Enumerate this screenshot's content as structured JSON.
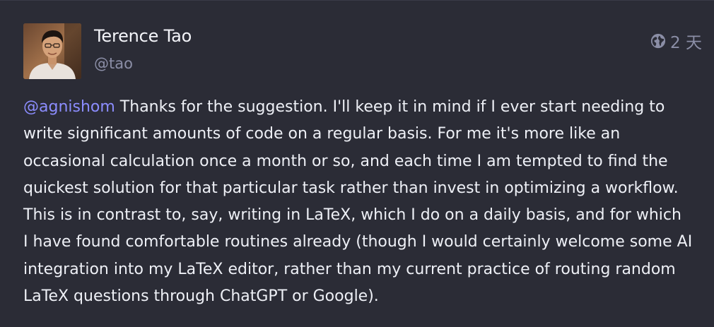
{
  "author": {
    "name": "Terence Tao",
    "handle": "@tao"
  },
  "timestamp": "2 天",
  "visibility_icon": "globe-icon",
  "post": {
    "mention": "@agnishom",
    "lines": [
      " Thanks for the suggestion.  I'll keep it in mind if I ever start needing to",
      "write significant amounts of code on a regular basis.  For me it's more like an",
      "occasional calculation once a month or so, and each time I am tempted to find the",
      "quickest solution for that particular task rather than invest in optimizing a workflow.",
      "This is in contrast to, say, writing in LaTeX, which I do on a daily basis, and for which",
      "I have found comfortable routines already (though I would certainly welcome some AI",
      "integration into my LaTeX editor, rather than my current practice of routing random",
      "LaTeX questions through ChatGPT or Google)."
    ]
  },
  "colors": {
    "background": "#2b2c36",
    "text": "#eef0f6",
    "muted": "#8b8ea6",
    "mention": "#8c8dff"
  }
}
